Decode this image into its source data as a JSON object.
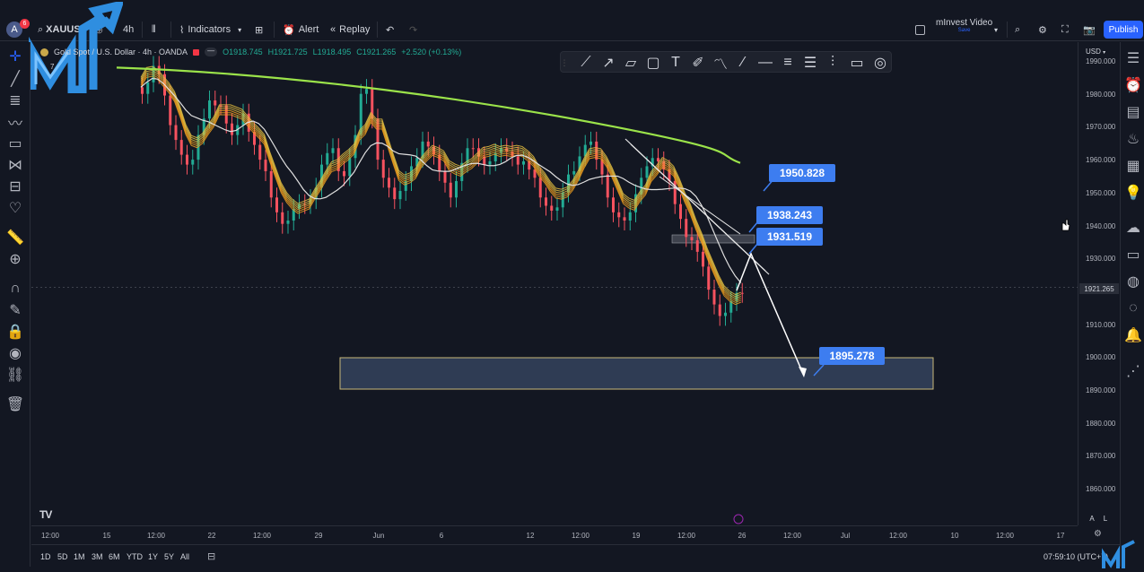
{
  "topbar": {
    "avatar_letter": "A",
    "avatar_badge": "6",
    "symbol": "XAUUSD",
    "interval": "4h",
    "indicators_label": "Indicators",
    "alert_label": "Alert",
    "replay_label": "Replay",
    "layout_name": "mInvest Video",
    "layout_sub": "Save",
    "publish_label": "Publish"
  },
  "legend": {
    "title": "Gold Spot / U.S. Dollar · 4h · OANDA",
    "open": "O1918.745",
    "high": "H1921.725",
    "low": "L1918.495",
    "close": "C1921.265",
    "change": "+2.520 (+0.13%)",
    "indicator_count": "7"
  },
  "price_axis": {
    "currency": "USD",
    "labels": [
      "1990.000",
      "1980.000",
      "1970.000",
      "1960.000",
      "1950.000",
      "1940.000",
      "1930.000",
      "1920.000",
      "1910.000",
      "1900.000",
      "1890.000",
      "1880.000",
      "1870.000",
      "1860.000"
    ],
    "current_price": "1921.265"
  },
  "time_axis": {
    "labels": [
      "12:00",
      "15",
      "12:00",
      "22",
      "12:00",
      "29",
      "Jun",
      "6",
      "12",
      "12:00",
      "19",
      "12:00",
      "26",
      "12:00",
      "Jul",
      "12:00",
      "10",
      "12:00",
      "17"
    ]
  },
  "callouts": {
    "a": "1950.828",
    "b": "1938.243",
    "c": "1931.519",
    "d": "1895.278"
  },
  "bottombar": {
    "ranges": [
      "1D",
      "5D",
      "1M",
      "3M",
      "6M",
      "YTD",
      "1Y",
      "5Y",
      "All"
    ],
    "clock": "07:59:10 (UTC+7)"
  },
  "axis_buttons": {
    "auto": "A",
    "log": "L"
  },
  "colors": {
    "background": "#131722",
    "up_candle": "#22ab94",
    "down_candle": "#f7525f",
    "ma_long": "#9be34a",
    "ma_white": "#e0e0e0",
    "ribbon": "#f0a020",
    "zone_fill": "#3a4a66",
    "zone_border": "#c9b87a",
    "callout": "#3d7df0",
    "accent": "#2962ff"
  },
  "icons": {
    "left": [
      "crosshair-icon",
      "trendline-icon",
      "fib-icon",
      "pattern-icon",
      "text-icon",
      "measure-icon",
      "forecast-icon",
      "heart-icon",
      "ruler-icon",
      "zoom-icon",
      "magnet-icon",
      "pencil-lock-icon",
      "lock-icon",
      "eye-icon",
      "link-icon",
      "trash-icon"
    ],
    "right": [
      "watchlist-icon",
      "alerts-icon",
      "news-icon",
      "hotlist-icon",
      "calendar-icon",
      "ideas-icon",
      "streams-icon",
      "chat-icon",
      "pine-icon",
      "notifications-icon",
      "ticker-icon",
      "pattern-recognition-icon"
    ]
  }
}
